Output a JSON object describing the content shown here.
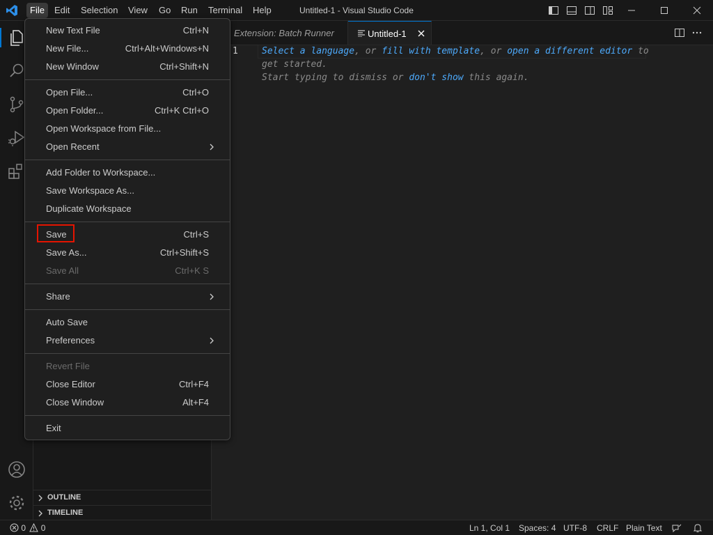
{
  "titlebar": {
    "menus": [
      "File",
      "Edit",
      "Selection",
      "View",
      "Go",
      "Run",
      "Terminal",
      "Help"
    ],
    "title": "Untitled-1 - Visual Studio Code",
    "accent": "#0078d4"
  },
  "editor": {
    "tabs": [
      {
        "label": "Extension: Batch Runner",
        "active": false
      },
      {
        "label": "Untitled-1",
        "active": true
      }
    ],
    "line_number": "1",
    "hint": {
      "link_select_language": "Select a language",
      "text_or1": ", or ",
      "link_fill_template": "fill with template",
      "text_or2": ", or ",
      "link_open_editor": "open a different editor",
      "text_to": " to",
      "line2": "get started.",
      "line3_start": "Start typing to dismiss or ",
      "link_dont_show": "don't show",
      "line3_end": " this again."
    }
  },
  "file_menu": {
    "items": [
      {
        "label": "New Text File",
        "shortcut": "Ctrl+N"
      },
      {
        "label": "New File...",
        "shortcut": "Ctrl+Alt+Windows+N"
      },
      {
        "label": "New Window",
        "shortcut": "Ctrl+Shift+N"
      },
      {
        "label": "Open File...",
        "shortcut": "Ctrl+O"
      },
      {
        "label": "Open Folder...",
        "shortcut": "Ctrl+K Ctrl+O"
      },
      {
        "label": "Open Workspace from File...",
        "shortcut": ""
      },
      {
        "label": "Open Recent",
        "shortcut": ""
      },
      {
        "label": "Add Folder to Workspace...",
        "shortcut": ""
      },
      {
        "label": "Save Workspace As...",
        "shortcut": ""
      },
      {
        "label": "Duplicate Workspace",
        "shortcut": ""
      },
      {
        "label": "Save",
        "shortcut": "Ctrl+S"
      },
      {
        "label": "Save As...",
        "shortcut": "Ctrl+Shift+S"
      },
      {
        "label": "Save All",
        "shortcut": "Ctrl+K S"
      },
      {
        "label": "Share",
        "shortcut": ""
      },
      {
        "label": "Auto Save",
        "shortcut": ""
      },
      {
        "label": "Preferences",
        "shortcut": ""
      },
      {
        "label": "Revert File",
        "shortcut": ""
      },
      {
        "label": "Close Editor",
        "shortcut": "Ctrl+F4"
      },
      {
        "label": "Close Window",
        "shortcut": "Alt+F4"
      },
      {
        "label": "Exit",
        "shortcut": ""
      }
    ],
    "highlight_color": "#e51400"
  },
  "sidebar": {
    "sections": [
      "OUTLINE",
      "TIMELINE"
    ]
  },
  "statusbar": {
    "errors": "0",
    "warnings": "0",
    "position": "Ln 1, Col 1",
    "spaces": "Spaces: 4",
    "encoding": "UTF-8",
    "eol": "CRLF",
    "language": "Plain Text"
  }
}
